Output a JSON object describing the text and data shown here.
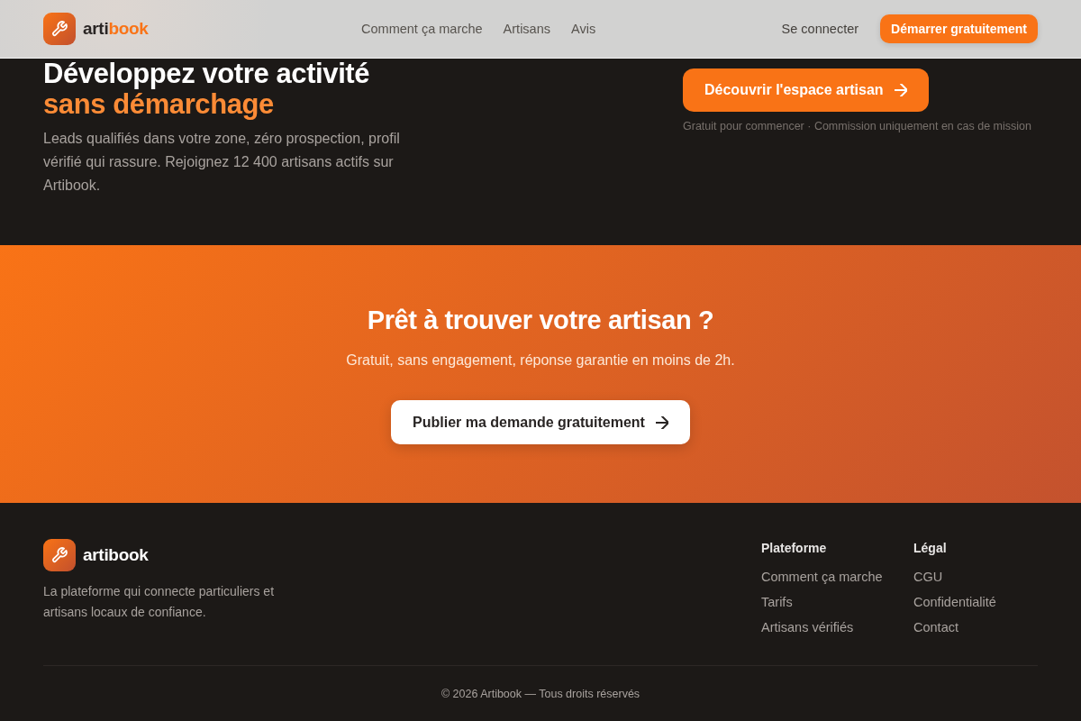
{
  "header": {
    "brand": {
      "name": "arti",
      "accent": "book"
    },
    "nav": [
      {
        "label": "Comment ça marche"
      },
      {
        "label": "Artisans"
      },
      {
        "label": "Avis"
      }
    ],
    "login": "Se connecter",
    "cta": "Démarrer gratuitement"
  },
  "hero": {
    "title": "Développez votre activité",
    "title_accent": "sans démarchage",
    "description": "Leads qualifiés dans votre zone, zéro prospection, profil vérifié qui rassure. Rejoignez 12 400 artisans actifs sur Artibook.",
    "button": "Découvrir l'espace artisan",
    "note": "Gratuit pour commencer · Commission uniquement en cas de mission"
  },
  "cta_band": {
    "title": "Prêt à trouver votre artisan ?",
    "subtitle": "Gratuit, sans engagement, réponse garantie en moins de 2h.",
    "button": "Publier ma demande gratuitement"
  },
  "footer": {
    "brand": "artibook",
    "tagline": "La plateforme qui connecte particuliers et artisans locaux de confiance.",
    "columns": [
      {
        "title": "Plateforme",
        "links": [
          "Comment ça marche",
          "Tarifs",
          "Artisans vérifiés"
        ]
      },
      {
        "title": "Légal",
        "links": [
          "CGU",
          "Confidentialité",
          "Contact"
        ]
      }
    ],
    "copyright": "© 2026 Artibook — Tous droits réservés"
  }
}
